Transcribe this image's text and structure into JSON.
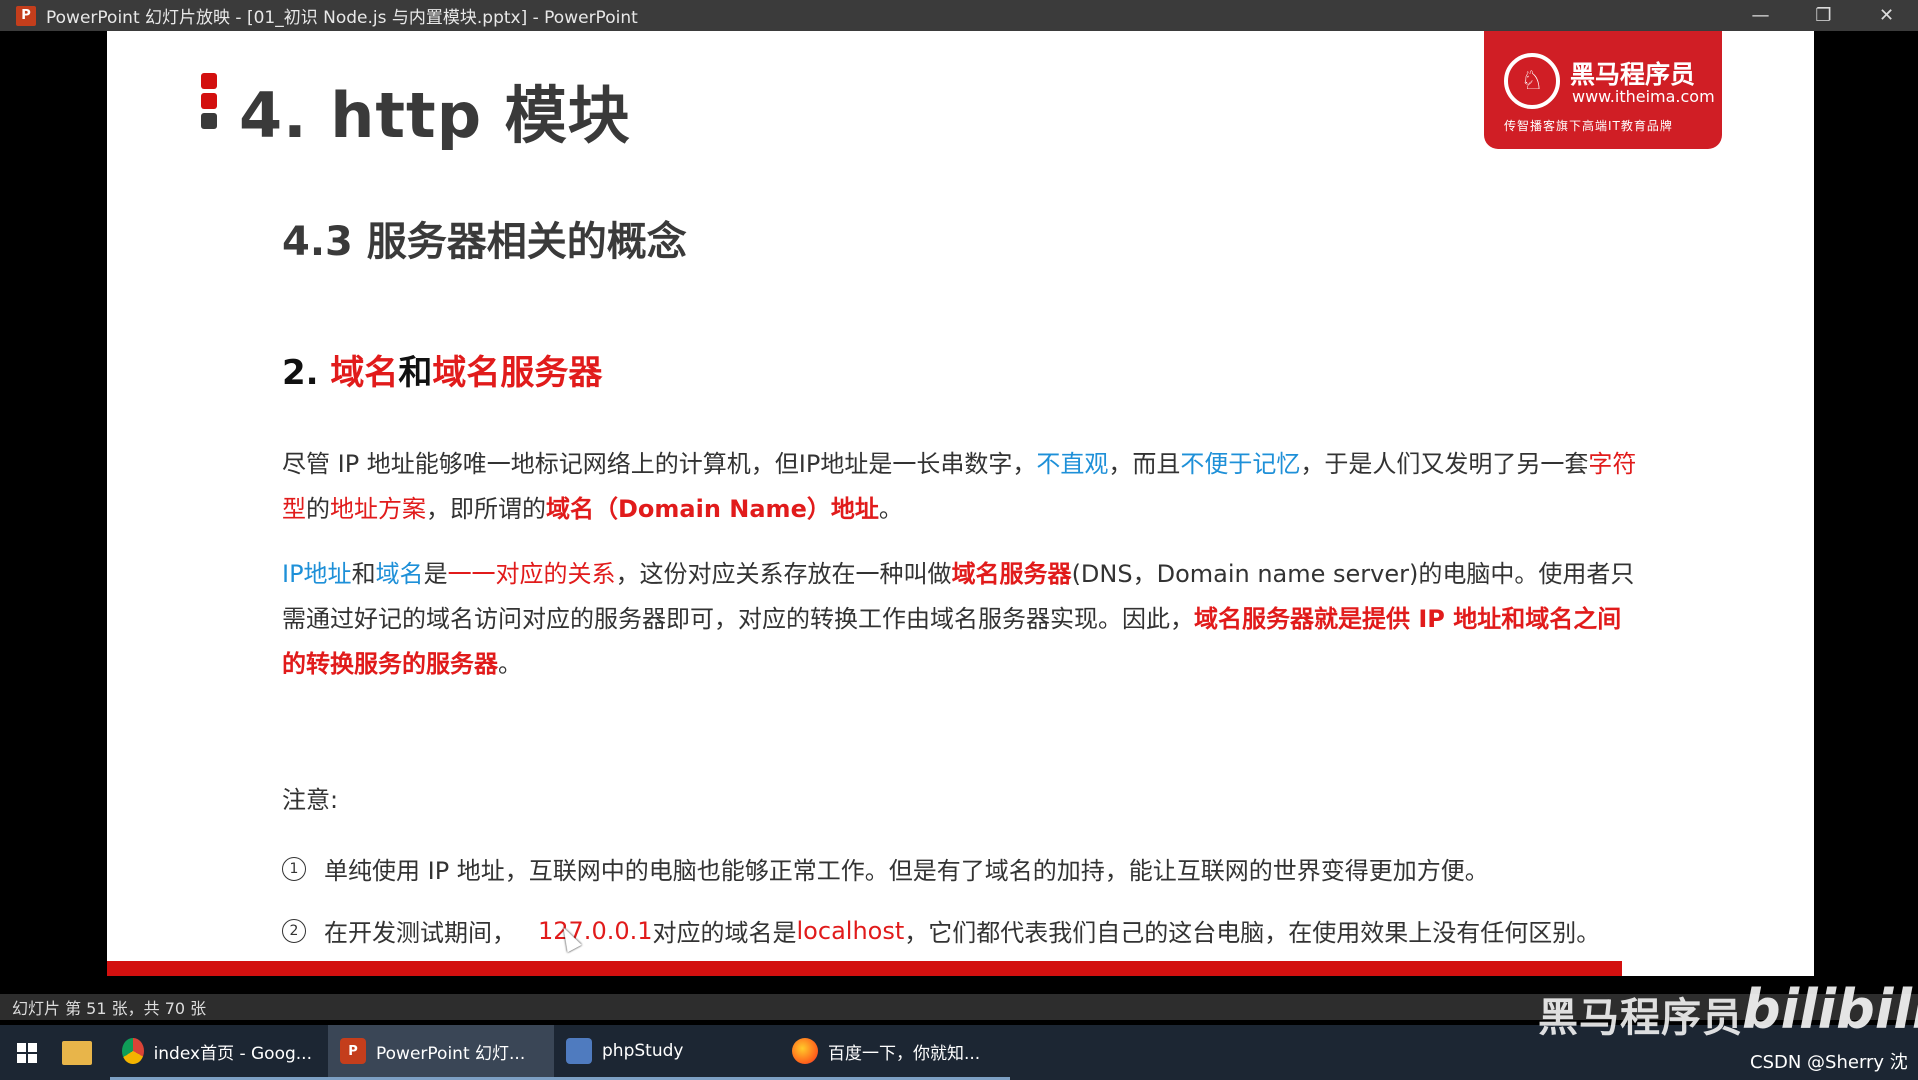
{
  "window": {
    "title": "PowerPoint 幻灯片放映 - [01_初识 Node.js 与内置模块.pptx] - PowerPoint",
    "app_icon_letter": "P",
    "minimize": "—",
    "restore": "❐",
    "close": "✕"
  },
  "slide": {
    "title": "4. http 模块",
    "subtitle": "4.3 服务器相关的概念",
    "heading": {
      "number": "2. ",
      "part1": "域名",
      "and": "和",
      "part2": "域名服务器"
    },
    "p1": {
      "a": "尽管 IP 地址能够唯一地标记网络上的计算机，但IP地址是一长串数字，",
      "b": "不直观",
      "c": "，而且",
      "d": "不便于记忆",
      "e": "，于是人们又发明了另一套",
      "f": "字符型",
      "g": "的",
      "h": "地址方案",
      "i": "，即所谓的",
      "j": "域名（Domain Name）地址",
      "k": "。"
    },
    "p2": {
      "a": "IP地址",
      "b": "和",
      "c": "域名",
      "d": "是",
      "e": "一一对应的关系",
      "f": "，这份对应关系存放在一种叫做",
      "g": "域名服务器",
      "h": "(DNS，Domain name server)的电脑中。使用者只需通过好记的域名访问对应的服务器即可，对应的转换工作由域名服务器实现。因此，",
      "i": "域名服务器就是提供 IP 地址和域名之间的转换服务的服务器",
      "j": "。"
    },
    "note_title": "注意:",
    "note1": {
      "num": "1",
      "text": "单纯使用 IP 地址，互联网中的电脑也能够正常工作。但是有了域名的加持，能让互联网的世界变得更加方便。"
    },
    "note2": {
      "num": "2",
      "a": "在开发测试期间，",
      "b": "127.0.0.1",
      "c": " 对应的域名是 ",
      "d": "localhost",
      "e": "，它们都代表我们自己的这台电脑，在使用效果上没有任何区别。"
    },
    "logo": {
      "name": "黑马程序员",
      "url": "www.itheima.com",
      "slogan": "传智播客旗下高端IT教育品牌"
    },
    "marker_colors": [
      "#d3100f",
      "#d3100f",
      "#3a3a3a"
    ]
  },
  "statusbar": {
    "slide_count": "幻灯片 第 51 张，共 70 张"
  },
  "taskbar": {
    "items": [
      {
        "label": "index首页 - Goog...",
        "icon": "chrome-icon"
      },
      {
        "label": "PowerPoint 幻灯...",
        "icon": "powerpoint-icon"
      },
      {
        "label": "phpStudy",
        "icon": "phpstudy-icon"
      },
      {
        "label": "百度一下，你就知...",
        "icon": "firefox-icon"
      }
    ],
    "ppt_letter": "P"
  },
  "overlay": {
    "watermark": "黑马程序员",
    "bilibili": "bilibili",
    "csdn": "CSDN @Sherry 沈"
  }
}
